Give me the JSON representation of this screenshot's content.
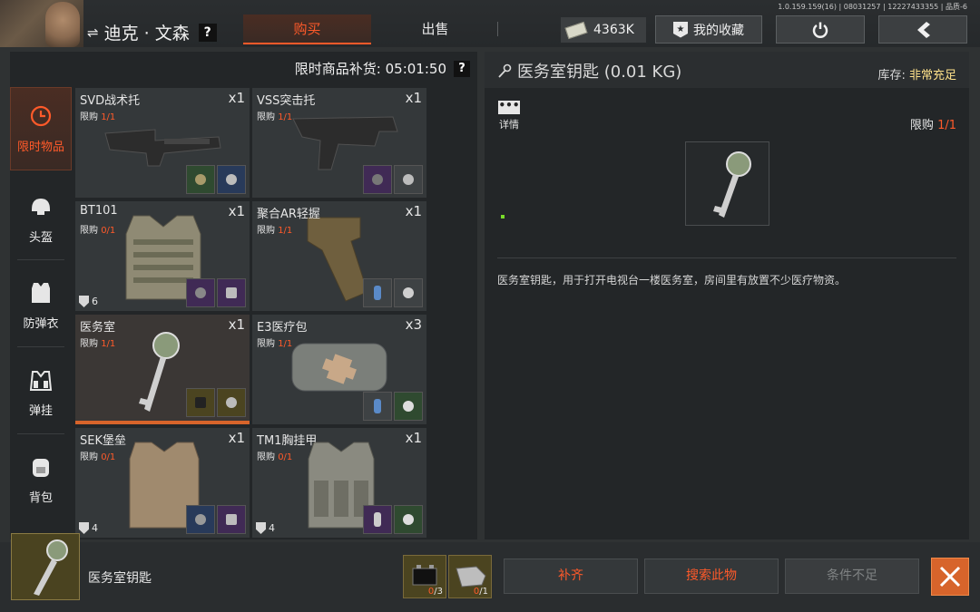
{
  "version": "1.0.159.159(16) | 08031257 | 12227433355 | 品质-6",
  "trader": {
    "name": "迪克 · 文森",
    "help": "?"
  },
  "tabs": {
    "buy": "购买",
    "sell": "出售"
  },
  "money": "4363K",
  "favorites_label": "我的收藏",
  "restock": {
    "label": "限时商品补货: 05:01:50",
    "help": "?"
  },
  "categories": [
    {
      "label": "限时物品",
      "icon": "clock-icon",
      "active": true
    },
    {
      "label": "头盔",
      "icon": "helmet-icon",
      "active": false
    },
    {
      "label": "防弹衣",
      "icon": "vest-icon",
      "active": false
    },
    {
      "label": "弹挂",
      "icon": "rig-icon",
      "active": false
    },
    {
      "label": "背包",
      "icon": "backpack-icon",
      "active": false
    }
  ],
  "items": [
    {
      "name": "SVD战术托",
      "qty": "x1",
      "limit_label": "限购",
      "limit": "1/1",
      "armor": ""
    },
    {
      "name": "VSS突击托",
      "qty": "x1",
      "limit_label": "限购",
      "limit": "1/1",
      "armor": ""
    },
    {
      "name": "BT101",
      "qty": "x1",
      "limit_label": "限购",
      "limit": "0/1",
      "armor": "6"
    },
    {
      "name": "聚合AR轻握",
      "qty": "x1",
      "limit_label": "限购",
      "limit": "1/1",
      "armor": ""
    },
    {
      "name": "医务室",
      "qty": "x1",
      "limit_label": "限购",
      "limit": "1/1",
      "armor": ""
    },
    {
      "name": "E3医疗包",
      "qty": "x3",
      "limit_label": "限购",
      "limit": "1/1",
      "armor": ""
    },
    {
      "name": "SEK堡垒",
      "qty": "x1",
      "limit_label": "限购",
      "limit": "0/1",
      "armor": "4"
    },
    {
      "name": "TM1胸挂甲",
      "qty": "x1",
      "limit_label": "限购",
      "limit": "0/1",
      "armor": "4"
    }
  ],
  "detail": {
    "title": "医务室钥匙 (0.01 KG)",
    "stock_label": "库存:",
    "stock_value": "非常充足",
    "info_label": "详情",
    "limit_label": "限购",
    "limit_value": "1/1",
    "description": "医务室钥匙，用于打开电视台一楼医务室，房间里有放置不少医疗物资。"
  },
  "bottom": {
    "item_name": "医务室钥匙",
    "costs": [
      {
        "have": "0",
        "need": "3"
      },
      {
        "have": "0",
        "need": "1"
      }
    ],
    "refill": "补齐",
    "search": "搜索此物",
    "insufficient": "条件不足"
  },
  "colors": {
    "accent": "#ff5a2a",
    "stock": "#ffe28a",
    "close": "#d7642b"
  }
}
